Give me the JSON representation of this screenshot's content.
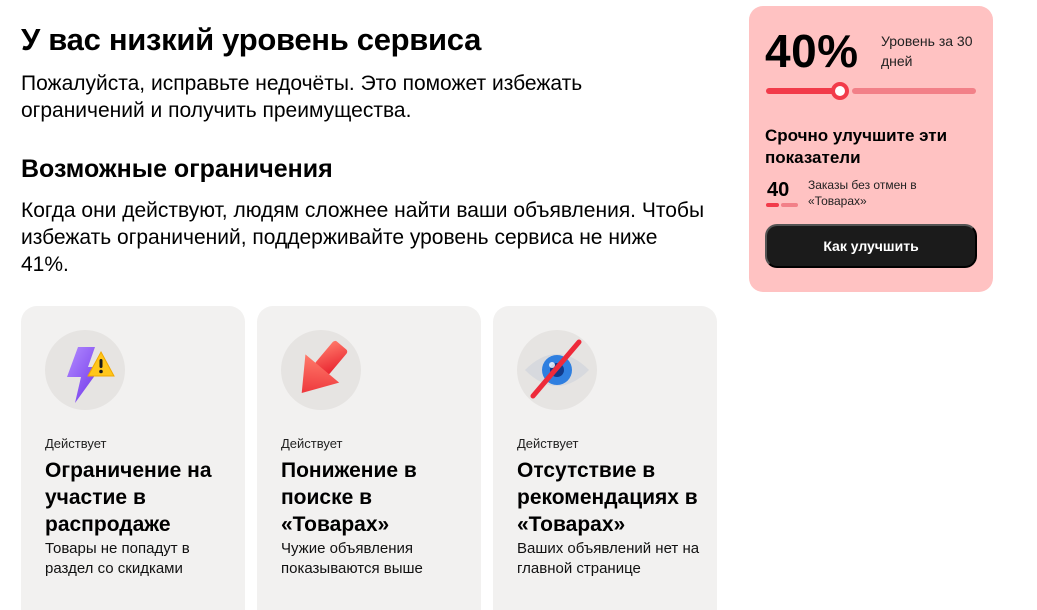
{
  "header": {
    "title": "У вас низкий уровень сервиса",
    "lead": "Пожалуйста, исправьте недочёты. Это поможет избежать ограничений и получить преимущества."
  },
  "restrictions": {
    "title": "Возможные ограничения",
    "description": "Когда они действуют, людям сложнее найти ваши объявления. Чтобы избежать ограничений, поддерживайте уровень сервиса не ниже 41%.",
    "cards": [
      {
        "icon": "lightning-warning-icon",
        "status": "Действует",
        "title": "Ограничение на участие в распродаже",
        "text": "Товары не попадут в раздел со скидками"
      },
      {
        "icon": "arrow-down-icon",
        "status": "Действует",
        "title": "Понижение в поиске в «Товарах»",
        "text": "Чужие объявления показываются выше"
      },
      {
        "icon": "eye-crossed-icon",
        "status": "Действует",
        "title": "Отсутствие в рекомендациях в «Товарах»",
        "text": "Ваших объявлений нет на главной странице"
      }
    ]
  },
  "service_panel": {
    "value": "40%",
    "level_label": "Уровень за 30 дней",
    "level_fraction": 0.35,
    "urgent_title": "Срочно улучшите эти показатели",
    "metric": {
      "value": "40",
      "fraction": 0.4,
      "label": "Заказы без отмен в «Товарах»"
    },
    "cta_label": "Как улучшить"
  },
  "colors": {
    "panel_bg": "#ffc2c2",
    "accent_red": "#f23b4a",
    "card_bg": "#f2f1f0",
    "button_bg": "#1b1b1b"
  }
}
